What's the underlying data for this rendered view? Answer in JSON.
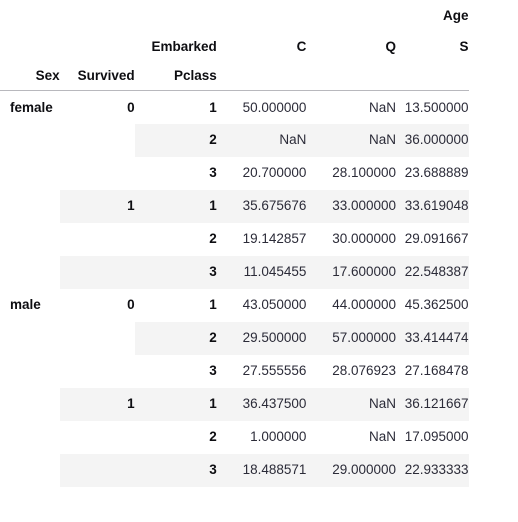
{
  "table": {
    "type": "pandas-multiindex-dataframe",
    "value_header": "Age",
    "column_index_name": "Embarked",
    "column_labels": [
      "C",
      "Q",
      "S"
    ],
    "row_index_names": [
      "Sex",
      "Survived",
      "Pclass"
    ],
    "rows": [
      {
        "sex": "female",
        "survived": "0",
        "pclass": "1",
        "values": [
          "50.000000",
          "NaN",
          "13.500000"
        ],
        "stripe": false,
        "stripe_from": 0
      },
      {
        "sex": "",
        "survived": "",
        "pclass": "2",
        "values": [
          "NaN",
          "NaN",
          "36.000000"
        ],
        "stripe": true,
        "stripe_from": 2
      },
      {
        "sex": "",
        "survived": "",
        "pclass": "3",
        "values": [
          "20.700000",
          "28.100000",
          "23.688889"
        ],
        "stripe": false,
        "stripe_from": 2
      },
      {
        "sex": "",
        "survived": "1",
        "pclass": "1",
        "values": [
          "35.675676",
          "33.000000",
          "33.619048"
        ],
        "stripe": true,
        "stripe_from": 1
      },
      {
        "sex": "",
        "survived": "",
        "pclass": "2",
        "values": [
          "19.142857",
          "30.000000",
          "29.091667"
        ],
        "stripe": false,
        "stripe_from": 2
      },
      {
        "sex": "",
        "survived": "",
        "pclass": "3",
        "values": [
          "11.045455",
          "17.600000",
          "22.548387"
        ],
        "stripe": true,
        "stripe_from": 1
      },
      {
        "sex": "male",
        "survived": "0",
        "pclass": "1",
        "values": [
          "43.050000",
          "44.000000",
          "45.362500"
        ],
        "stripe": false,
        "stripe_from": 0
      },
      {
        "sex": "",
        "survived": "",
        "pclass": "2",
        "values": [
          "29.500000",
          "57.000000",
          "33.414474"
        ],
        "stripe": true,
        "stripe_from": 2
      },
      {
        "sex": "",
        "survived": "",
        "pclass": "3",
        "values": [
          "27.555556",
          "28.076923",
          "27.168478"
        ],
        "stripe": false,
        "stripe_from": 2
      },
      {
        "sex": "",
        "survived": "1",
        "pclass": "1",
        "values": [
          "36.437500",
          "NaN",
          "36.121667"
        ],
        "stripe": true,
        "stripe_from": 1
      },
      {
        "sex": "",
        "survived": "",
        "pclass": "2",
        "values": [
          "1.000000",
          "NaN",
          "17.095000"
        ],
        "stripe": false,
        "stripe_from": 2
      },
      {
        "sex": "",
        "survived": "",
        "pclass": "3",
        "values": [
          "18.488571",
          "29.000000",
          "22.933333"
        ],
        "stripe": true,
        "stripe_from": 1
      }
    ]
  },
  "colors": {
    "stripe": "#f4f4f4",
    "rule": "#b8b8bd",
    "index_text": "#0e0e12",
    "value_text": "#2b2b38",
    "background": "#ffffff"
  }
}
